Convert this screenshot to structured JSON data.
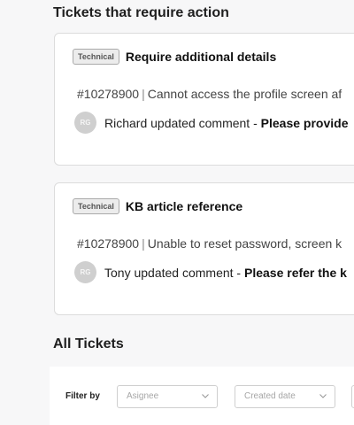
{
  "sections": {
    "action_title": "Tickets that require action",
    "all_title": "All Tickets"
  },
  "tickets": [
    {
      "tag": "Technical",
      "title": "Require additional details",
      "id": "#10278900",
      "separator": "|",
      "summary": "Cannot access the profile screen af",
      "avatar_initials": "RG",
      "comment_author": "Richard updated comment",
      "comment_dash": " - ",
      "comment_text": "Please provide"
    },
    {
      "tag": "Technical",
      "title": "KB article reference",
      "id": "#10278900",
      "separator": "|",
      "summary": "Unable to reset password, screen k",
      "avatar_initials": "RG",
      "comment_author": "Tony updated comment",
      "comment_dash": " - ",
      "comment_text": "Please refer the k"
    }
  ],
  "filters": {
    "label": "Filter by",
    "assignee_placeholder": "Asignee",
    "created_placeholder": "Created date"
  },
  "icons": {
    "dropdown": "chevron-down-icon"
  }
}
